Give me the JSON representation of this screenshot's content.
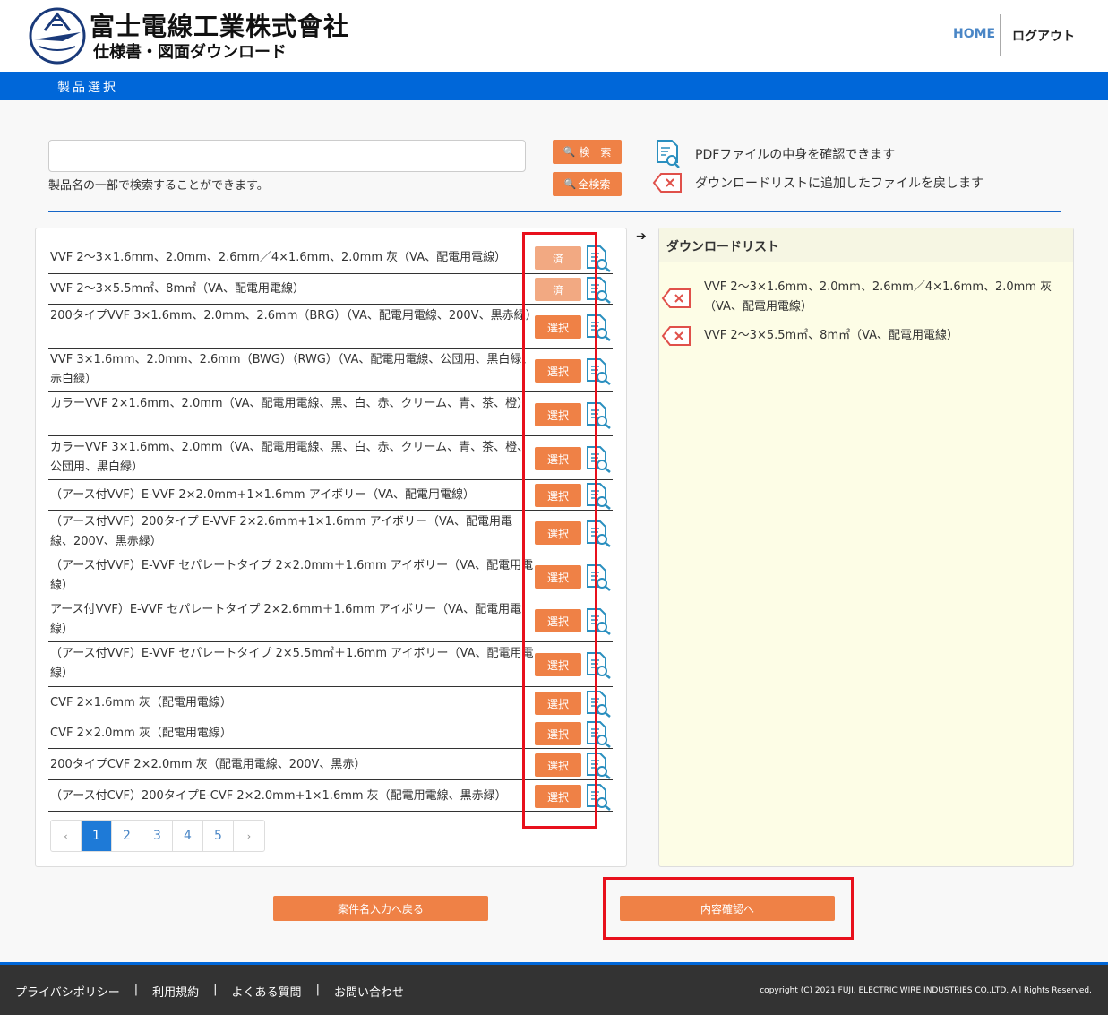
{
  "header": {
    "company_name": "富士電線工業株式會社",
    "subtitle": "仕様書・図面ダウンロード",
    "nav_home": "HOME",
    "nav_logout": "ログアウト"
  },
  "section_title": "製品選択",
  "search": {
    "placeholder": "",
    "hint": "製品名の一部で検索することができます。",
    "search_button": "検　索",
    "all_search_button": "全検索"
  },
  "legend": {
    "pdf_text": "PDFファイルの中身を確認できます",
    "remove_text": "ダウンロードリストに追加したファイルを戻します"
  },
  "products": [
    {
      "name": "VVF 2～3×1.6mm、2.0mm、2.6mm／4×1.6mm、2.0mm 灰（VA、配電用電線）",
      "button": "済"
    },
    {
      "name": "VVF 2～3×5.5m㎡、8m㎡（VA、配電用電線）",
      "button": "済"
    },
    {
      "name": "200タイプVVF 3×1.6mm、2.0mm、2.6mm（BRG）（VA、配電用電線、200V、黒赤緑）",
      "button": "選択"
    },
    {
      "name": "VVF 3×1.6mm、2.0mm、2.6mm（BWG）（RWG）（VA、配電用電線、公団用、黒白緑、赤白緑）",
      "button": "選択"
    },
    {
      "name": "カラーVVF 2×1.6mm、2.0mm（VA、配電用電線、黒、白、赤、クリーム、青、茶、橙）",
      "button": "選択"
    },
    {
      "name": "カラーVVF 3×1.6mm、2.0mm（VA、配電用電線、黒、白、赤、クリーム、青、茶、橙、公団用、黒白緑）",
      "button": "選択"
    },
    {
      "name": "（アース付VVF）E-VVF 2×2.0mm+1×1.6mm アイボリー（VA、配電用電線）",
      "button": "選択"
    },
    {
      "name": "（アース付VVF）200タイプ E-VVF 2×2.6mm+1×1.6mm アイボリー（VA、配電用電線、200V、黒赤緑）",
      "button": "選択"
    },
    {
      "name": "（アース付VVF）E-VVF セパレートタイプ 2×2.0mm＋1.6mm アイボリー（VA、配電用電線）",
      "button": "選択"
    },
    {
      "name": "アース付VVF）E-VVF セパレートタイプ 2×2.6mm＋1.6mm アイボリー（VA、配電用電線）",
      "button": "選択"
    },
    {
      "name": "（アース付VVF）E-VVF セパレートタイプ 2×5.5m㎡＋1.6mm アイボリー（VA、配電用電線）",
      "button": "選択"
    },
    {
      "name": "CVF 2×1.6mm 灰（配電用電線）",
      "button": "選択"
    },
    {
      "name": "CVF 2×2.0mm 灰（配電用電線）",
      "button": "選択"
    },
    {
      "name": "200タイプCVF 2×2.0mm 灰（配電用電線、200V、黒赤）",
      "button": "選択"
    },
    {
      "name": "（アース付CVF）200タイプE-CVF 2×2.0mm+1×1.6mm 灰（配電用電線、黒赤緑）",
      "button": "選択"
    }
  ],
  "pagination": {
    "prev": "‹",
    "pages": [
      "1",
      "2",
      "3",
      "4",
      "5"
    ],
    "next": "›",
    "current": "1"
  },
  "download_list": {
    "arrow": "➔",
    "title": "ダウンロードリスト",
    "items": [
      "VVF 2～3×1.6mm、2.0mm、2.6mm／4×1.6mm、2.0mm 灰（VA、配電用電線）",
      "VVF 2～3×5.5m㎡、8m㎡（VA、配電用電線）"
    ]
  },
  "buttons": {
    "back": "案件名入力へ戻る",
    "confirm": "内容確認へ"
  },
  "footer": {
    "links": [
      "プライバシポリシー",
      "利用規約",
      "よくある質問",
      "お問い合わせ"
    ],
    "separator": "|",
    "copyright": "copyright (C) 2021 FUJI. ELECTRIC WIRE INDUSTRIES CO.,LTD. All Rights Reserved."
  },
  "colors": {
    "brand_blue": "#0067d9",
    "button_orange": "#ef8146",
    "button_done": "#f2a982",
    "highlight_red": "#e8101c",
    "download_bg": "#fdfde6"
  },
  "icons": {
    "search": "magnifier-icon",
    "pdf_preview": "document-magnifier-icon",
    "remove": "remove-x-icon"
  }
}
